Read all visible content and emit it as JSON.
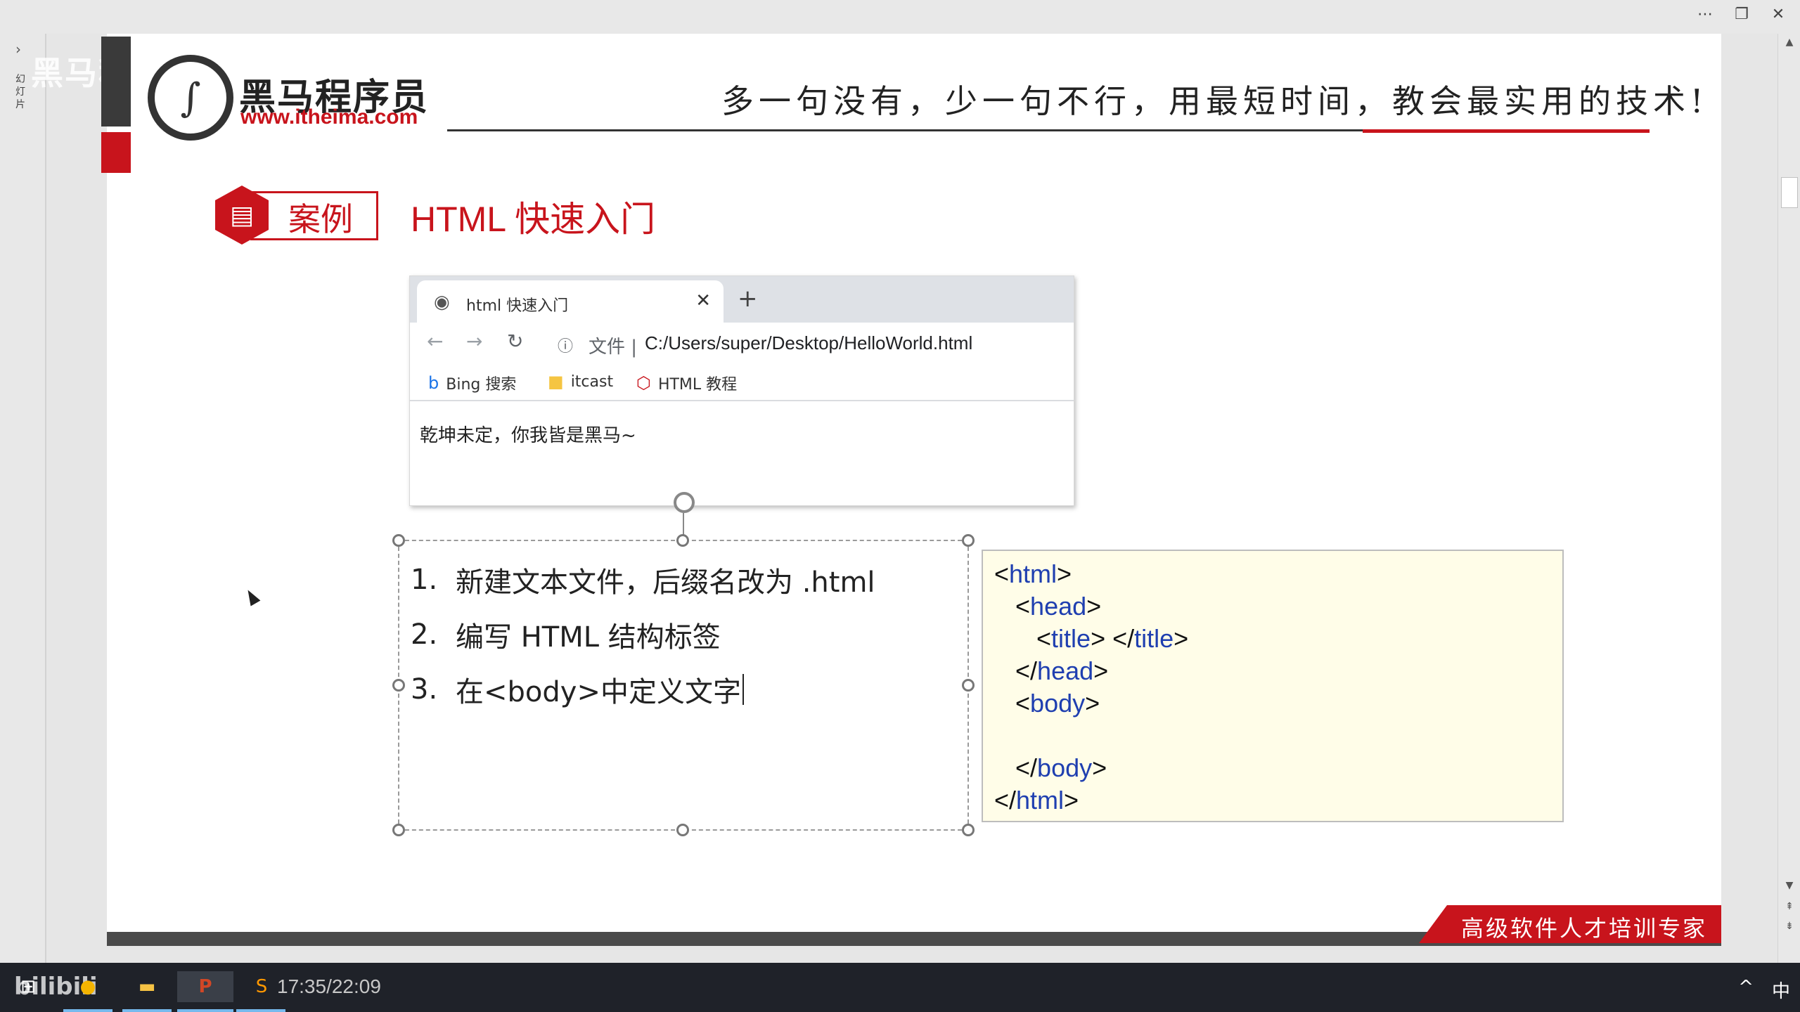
{
  "window": {
    "more_icon": "more-icon",
    "restore_icon": "restore-icon",
    "close_icon": "close-icon"
  },
  "rail": {
    "label": "幻灯片",
    "watermark": "黑马程"
  },
  "slide": {
    "logo_cn": "黑马程序员",
    "logo_url": "www.itheima.com",
    "slogan": "多一句没有，少一句不行，用最短时间，教会最实用的技术!",
    "badge_label": "案例",
    "title": "HTML 快速入门",
    "footer_text": "高级软件人才培训专家",
    "browser": {
      "tab_title": "html 快速入门",
      "address_label": "文件",
      "address_url": "C:/Users/super/Desktop/HelloWorld.html",
      "bookmarks": [
        {
          "label": "Bing 搜索"
        },
        {
          "label": "itcast"
        },
        {
          "label": "HTML 教程"
        }
      ],
      "page_text": "乾坤未定，你我皆是黑马~"
    },
    "steps": [
      {
        "num": "1.",
        "text": "新建文本文件，后缀名改为 .html"
      },
      {
        "num": "2.",
        "text": "编写 HTML 结构标签"
      },
      {
        "num": "3.",
        "text": "在<body>中定义文字"
      }
    ],
    "code_lines": [
      {
        "indent": "",
        "open": "<",
        "name": "html",
        "close": ">",
        "extra_open": "",
        "extra_name": "",
        "extra_close": ""
      },
      {
        "indent": "   ",
        "open": "<",
        "name": "head",
        "close": ">",
        "extra_open": "",
        "extra_name": "",
        "extra_close": ""
      },
      {
        "indent": "      ",
        "open": "<",
        "name": "title",
        "close": ">",
        "extra_open": " </",
        "extra_name": "title",
        "extra_close": ">"
      },
      {
        "indent": "   ",
        "open": "</",
        "name": "head",
        "close": ">",
        "extra_open": "",
        "extra_name": "",
        "extra_close": ""
      },
      {
        "indent": "   ",
        "open": "<",
        "name": "body",
        "close": ">",
        "extra_open": "",
        "extra_name": "",
        "extra_close": ""
      },
      {
        "indent": "",
        "open": "",
        "name": "",
        "close": "",
        "extra_open": "",
        "extra_name": "",
        "extra_close": ""
      },
      {
        "indent": "   ",
        "open": "</",
        "name": "body",
        "close": ">",
        "extra_open": "",
        "extra_name": "",
        "extra_close": ""
      },
      {
        "indent": "",
        "open": "</",
        "name": "html",
        "close": ">",
        "extra_open": "",
        "extra_name": "",
        "extra_close": ""
      }
    ]
  },
  "taskbar": {
    "watermark": "bilibili",
    "time": "17:35/22:09",
    "tray_ime": "中"
  },
  "colors": {
    "brand_red": "#c8141c",
    "code_tag": "#1f3fb0",
    "code_bg": "#fffde8"
  }
}
